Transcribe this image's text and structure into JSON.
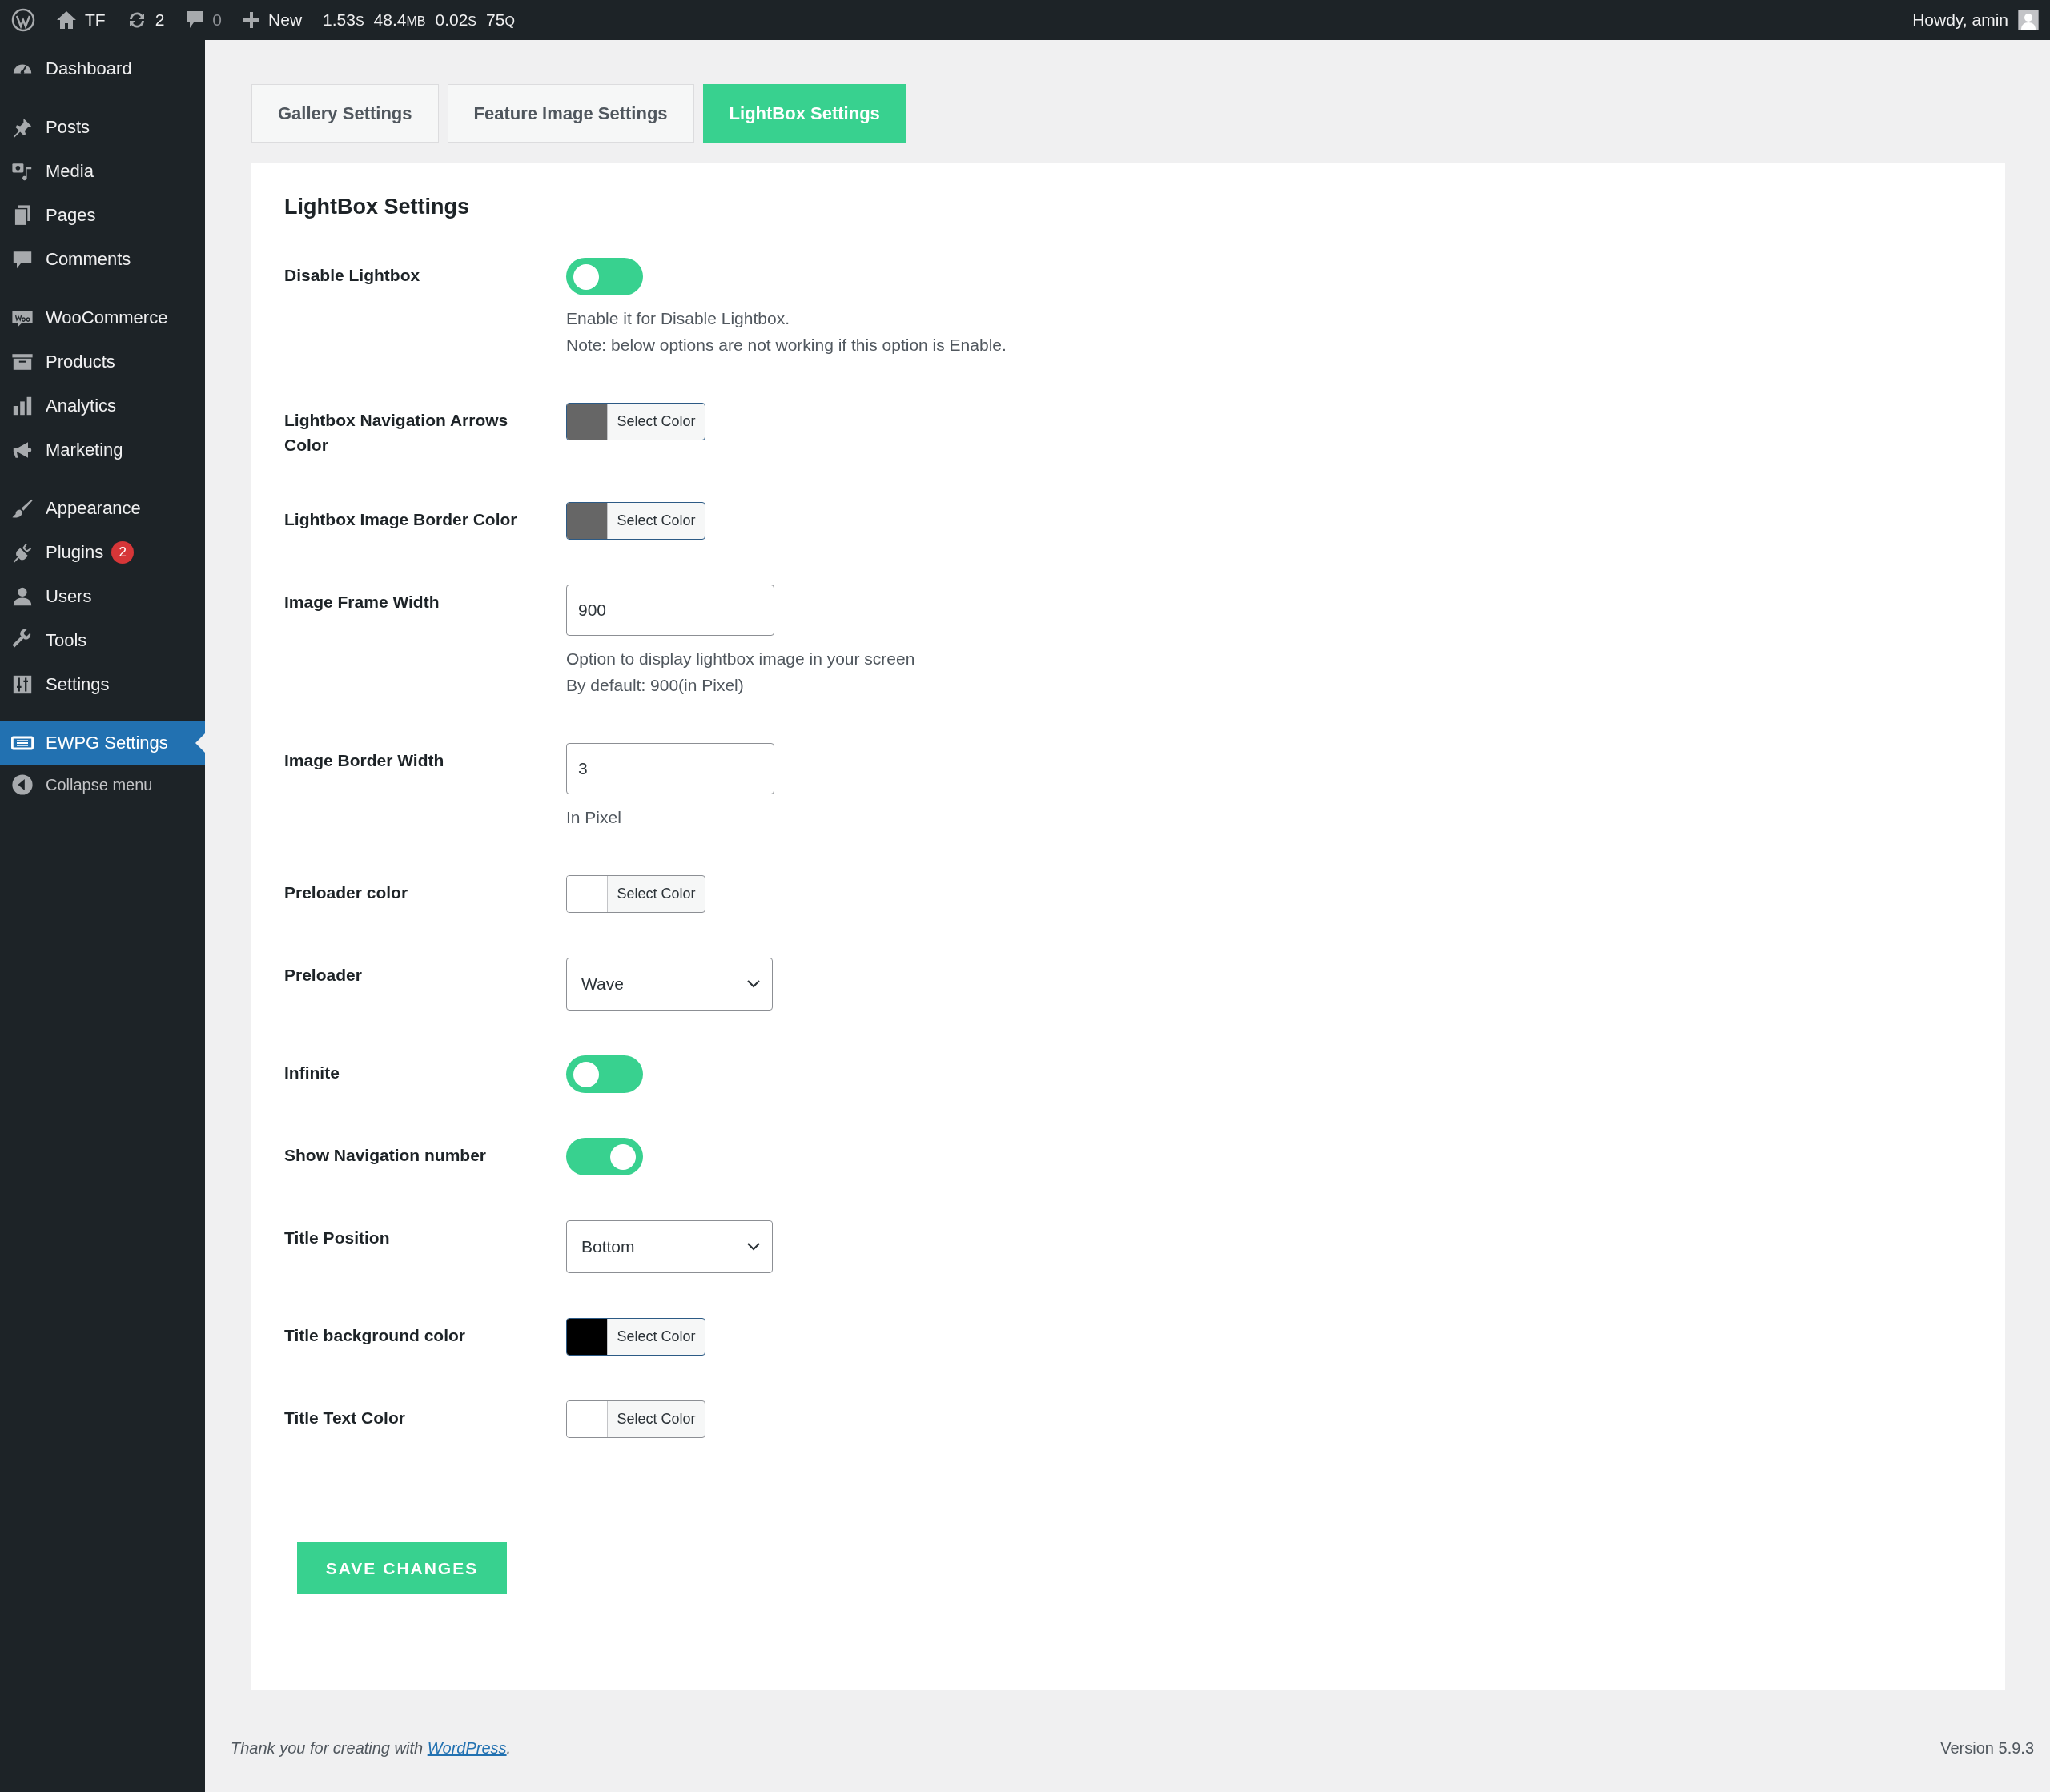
{
  "admin_bar": {
    "site": "TF",
    "updates": "2",
    "comments": "0",
    "new": "New",
    "stats": [
      {
        "value": "1.53",
        "unit": "S"
      },
      {
        "value": "48.4",
        "unit": "MB"
      },
      {
        "value": "0.02",
        "unit": "S"
      },
      {
        "value": "75",
        "unit": "Q"
      }
    ],
    "greeting": "Howdy, amin"
  },
  "sidebar": {
    "groups": [
      [
        {
          "label": "Dashboard",
          "selected": false
        }
      ],
      [
        {
          "label": "Posts",
          "selected": false
        },
        {
          "label": "Media",
          "selected": false
        },
        {
          "label": "Pages",
          "selected": false
        },
        {
          "label": "Comments",
          "selected": false
        }
      ],
      [
        {
          "label": "WooCommerce",
          "selected": false
        },
        {
          "label": "Products",
          "selected": false
        },
        {
          "label": "Analytics",
          "selected": false
        },
        {
          "label": "Marketing",
          "selected": false
        }
      ],
      [
        {
          "label": "Appearance",
          "selected": false
        },
        {
          "label": "Plugins",
          "selected": false,
          "badge": "2"
        },
        {
          "label": "Users",
          "selected": false
        },
        {
          "label": "Tools",
          "selected": false
        },
        {
          "label": "Settings",
          "selected": false
        }
      ],
      [
        {
          "label": "EWPG Settings",
          "selected": true
        }
      ]
    ],
    "collapse": "Collapse menu"
  },
  "tabs": [
    {
      "label": "Gallery Settings",
      "selected": false
    },
    {
      "label": "Feature Image Settings",
      "selected": false
    },
    {
      "label": "LightBox Settings",
      "selected": true
    }
  ],
  "panel": {
    "title": "LightBox Settings",
    "settings": [
      {
        "kind": "toggle",
        "label": "Disable Lightbox",
        "on": false,
        "description": [
          "Enable it for Disable Lightbox.",
          "Note: below options are not working if this option is Enable."
        ]
      },
      {
        "kind": "color",
        "label": "Lightbox Navigation Arrows Color",
        "color": "#666666",
        "button": "Select Color"
      },
      {
        "kind": "color",
        "label": "Lightbox Image Border Color",
        "color": "#666666",
        "button": "Select Color"
      },
      {
        "kind": "text",
        "label": "Image Frame Width",
        "value": "900",
        "description": [
          "Option to display lightbox image in your screen",
          "By default: 900(in Pixel)"
        ]
      },
      {
        "kind": "text",
        "label": "Image Border Width",
        "value": "3",
        "description": [
          "In Pixel"
        ]
      },
      {
        "kind": "color",
        "label": "Preloader color",
        "color": "#ffffff",
        "button": "Select Color"
      },
      {
        "kind": "select",
        "label": "Preloader",
        "value": "Wave"
      },
      {
        "kind": "toggle",
        "label": "Infinite",
        "on": false
      },
      {
        "kind": "toggle",
        "label": "Show Navigation number",
        "on": true
      },
      {
        "kind": "select",
        "label": "Title Position",
        "value": "Bottom"
      },
      {
        "kind": "color",
        "label": "Title background color",
        "color": "#000000",
        "button": "Select Color"
      },
      {
        "kind": "color",
        "label": "Title Text Color",
        "color": "#ffffff",
        "button": "Select Color"
      }
    ],
    "save_button": "SAVE CHANGES"
  },
  "footer": {
    "text": "Thank you for creating with ",
    "link": "WordPress",
    "after": ".",
    "version": "Version 5.9.3"
  }
}
